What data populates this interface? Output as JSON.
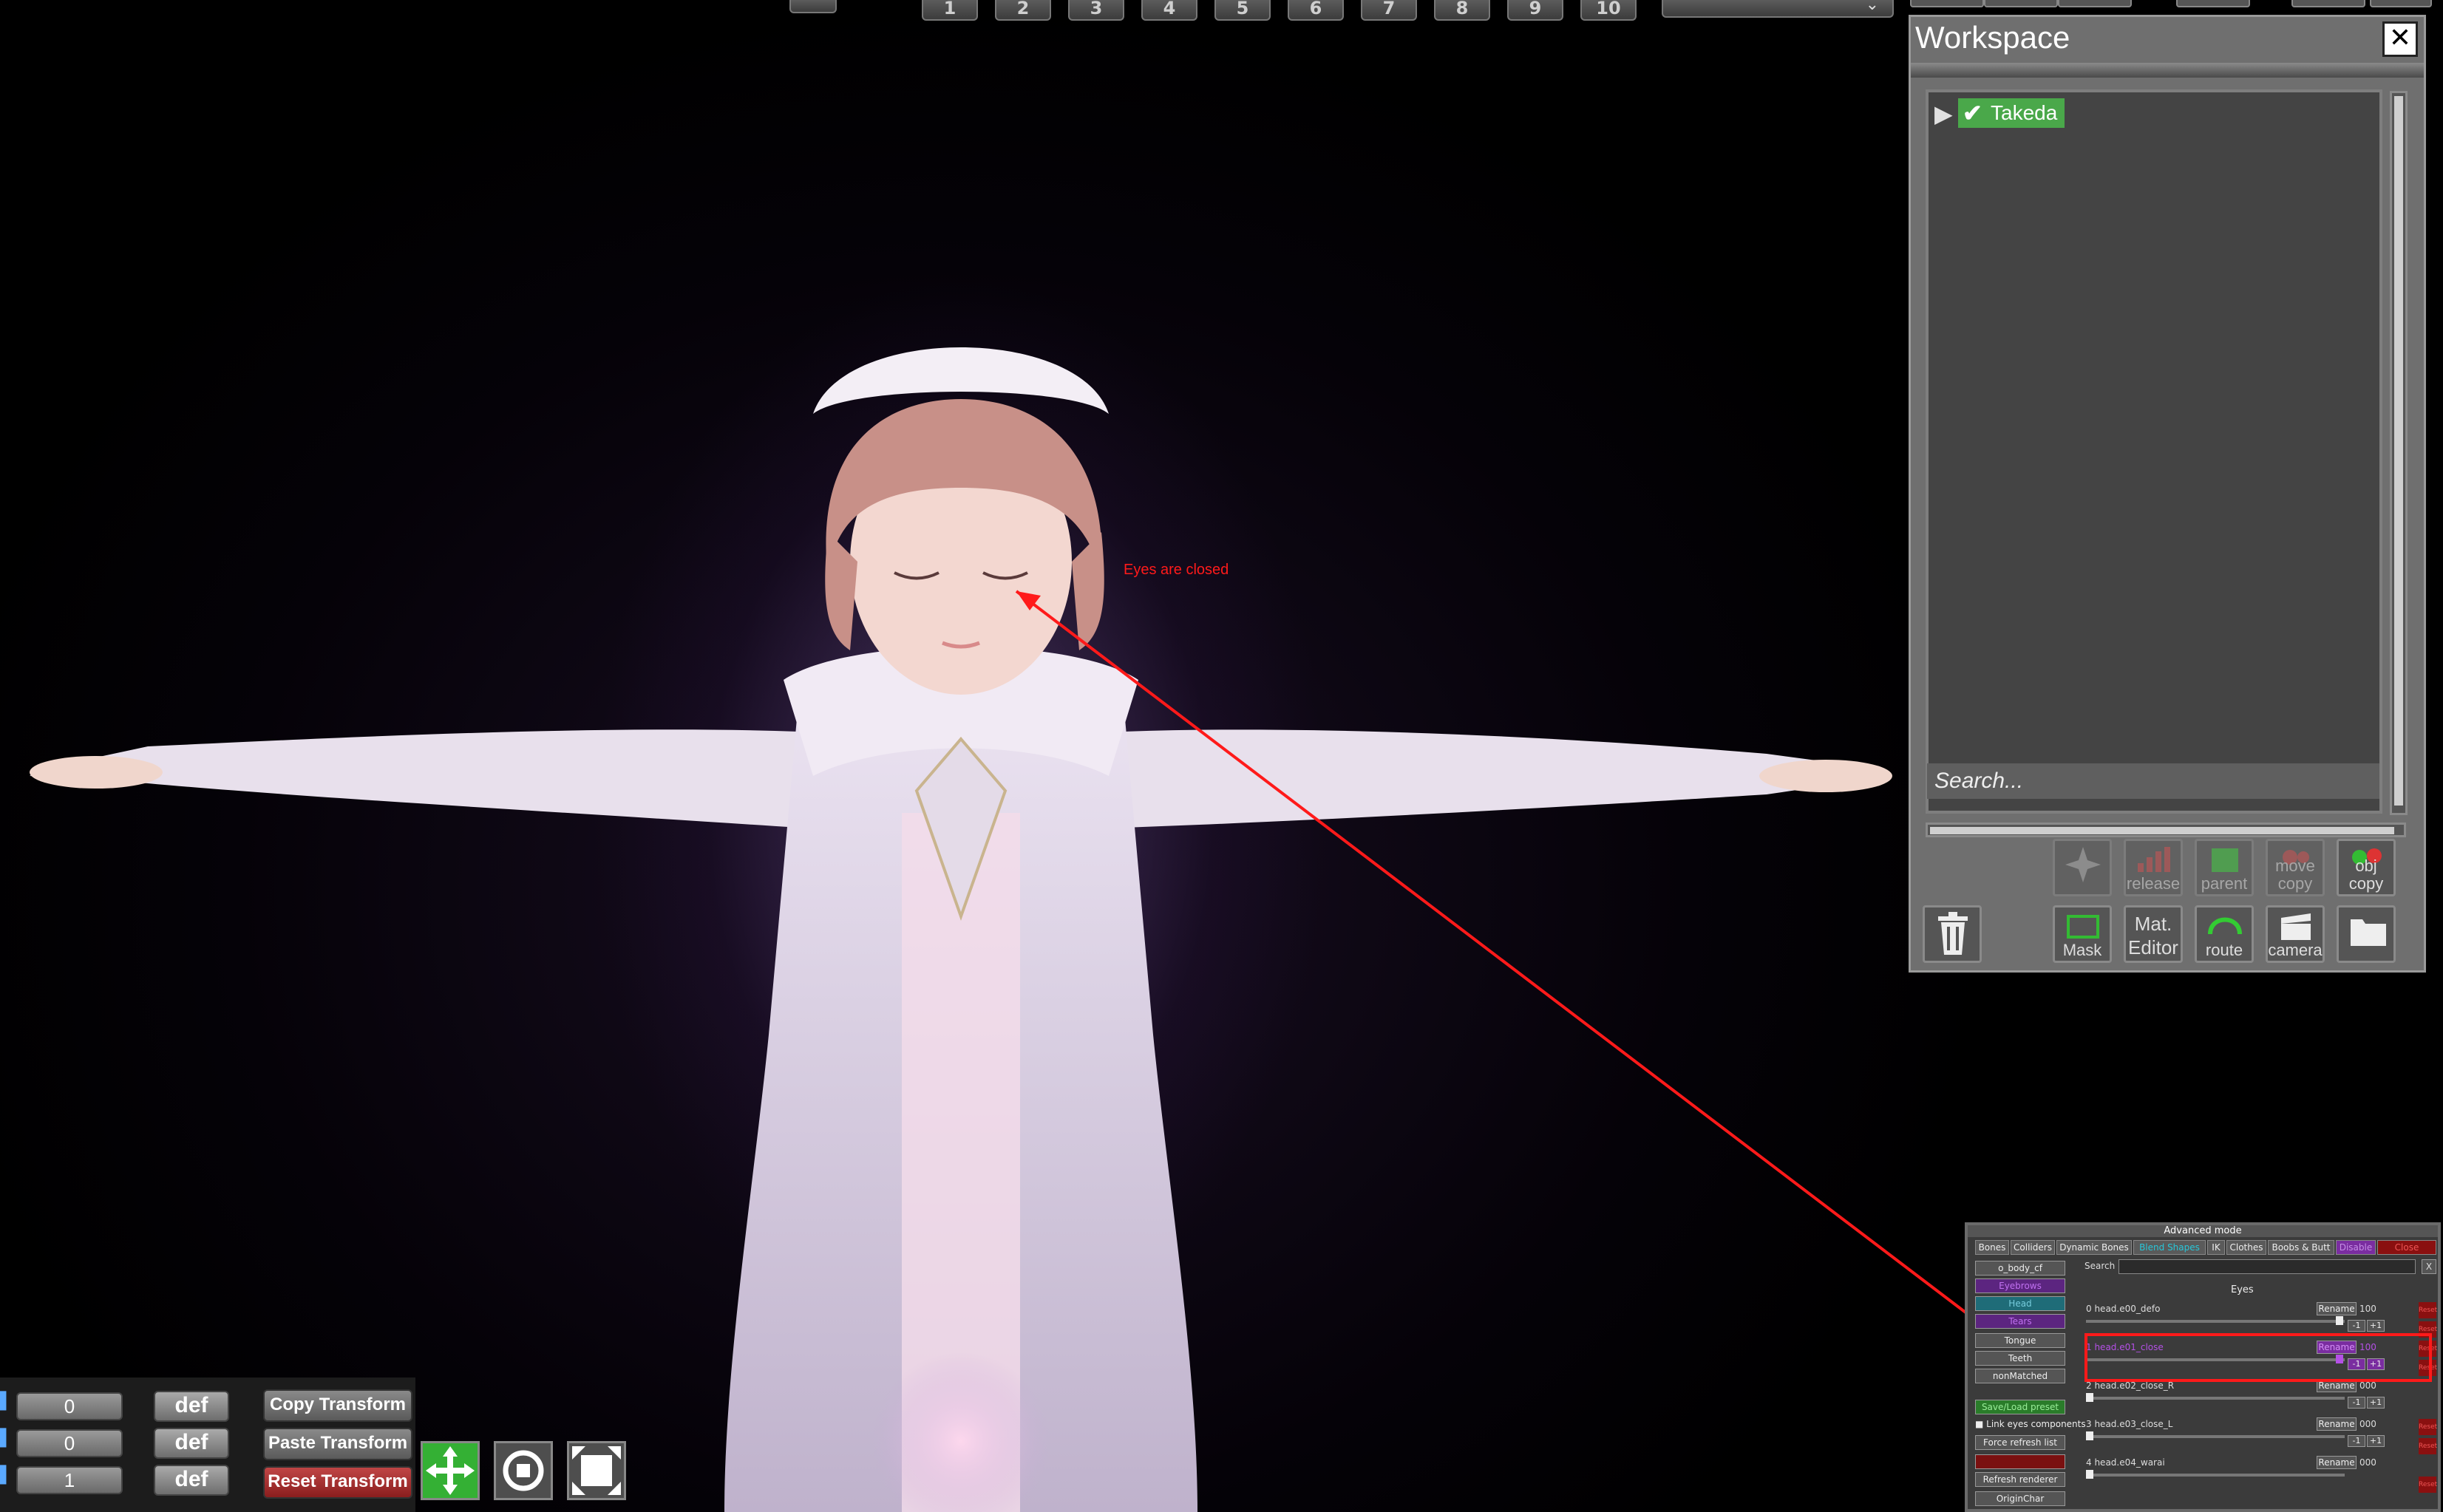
{
  "toolbar": {
    "number_buttons": [
      "1",
      "2",
      "3",
      "4",
      "5",
      "6",
      "7",
      "8",
      "9",
      "10"
    ]
  },
  "workspace": {
    "title": "Workspace",
    "close_icon": "close-icon",
    "tree_node_label": "Takeda",
    "search_placeholder": "Search...",
    "buttons": {
      "release": "release",
      "parent": "parent",
      "move_copy": "move copy",
      "obj_copy": "obj copy",
      "mask": "Mask",
      "mat_editor": "Mat. Editor",
      "route": "route",
      "camera": "camera"
    }
  },
  "annotation": {
    "text": "Eyes are closed",
    "color": "#ff1a1a"
  },
  "advanced": {
    "title": "Advanced mode",
    "tabs": [
      "Bones",
      "Colliders",
      "Dynamic Bones",
      "Blend Shapes",
      "IK",
      "Clothes",
      "Boobs & Butt",
      "Disable",
      "Close"
    ],
    "categories": [
      "o_body_cf",
      "Eyebrows",
      "Head",
      "Tears",
      "Tongue",
      "Teeth",
      "nonMatched"
    ],
    "save_load_preset": "Save/Load preset",
    "link_eyes": "Link eyes components",
    "force_refresh": "Force refresh list",
    "refresh_renderer": "Refresh renderer",
    "origin_char": "OriginChar",
    "search_label": "Search",
    "clear_x": "X",
    "group_label": "Eyes",
    "rename_label": "Rename",
    "reset_label": "Reset",
    "minus_label": "-1",
    "plus_label": "+1",
    "rows": [
      {
        "name": "0 head.e00_defo",
        "value": "100"
      },
      {
        "name": "1 head.e01_close",
        "value": "100"
      },
      {
        "name": "2 head.e02_close_R",
        "value": "000"
      },
      {
        "name": "3 head.e03_close_L",
        "value": "000"
      },
      {
        "name": "4 head.e04_warai",
        "value": "000"
      }
    ]
  },
  "transform": {
    "values": [
      "0",
      "0",
      "1"
    ],
    "def_label": "def",
    "copy": "Copy Transform",
    "paste": "Paste Transform",
    "reset": "Reset Transform",
    "tools": [
      "move-icon",
      "rotate-icon",
      "scale-icon"
    ]
  }
}
